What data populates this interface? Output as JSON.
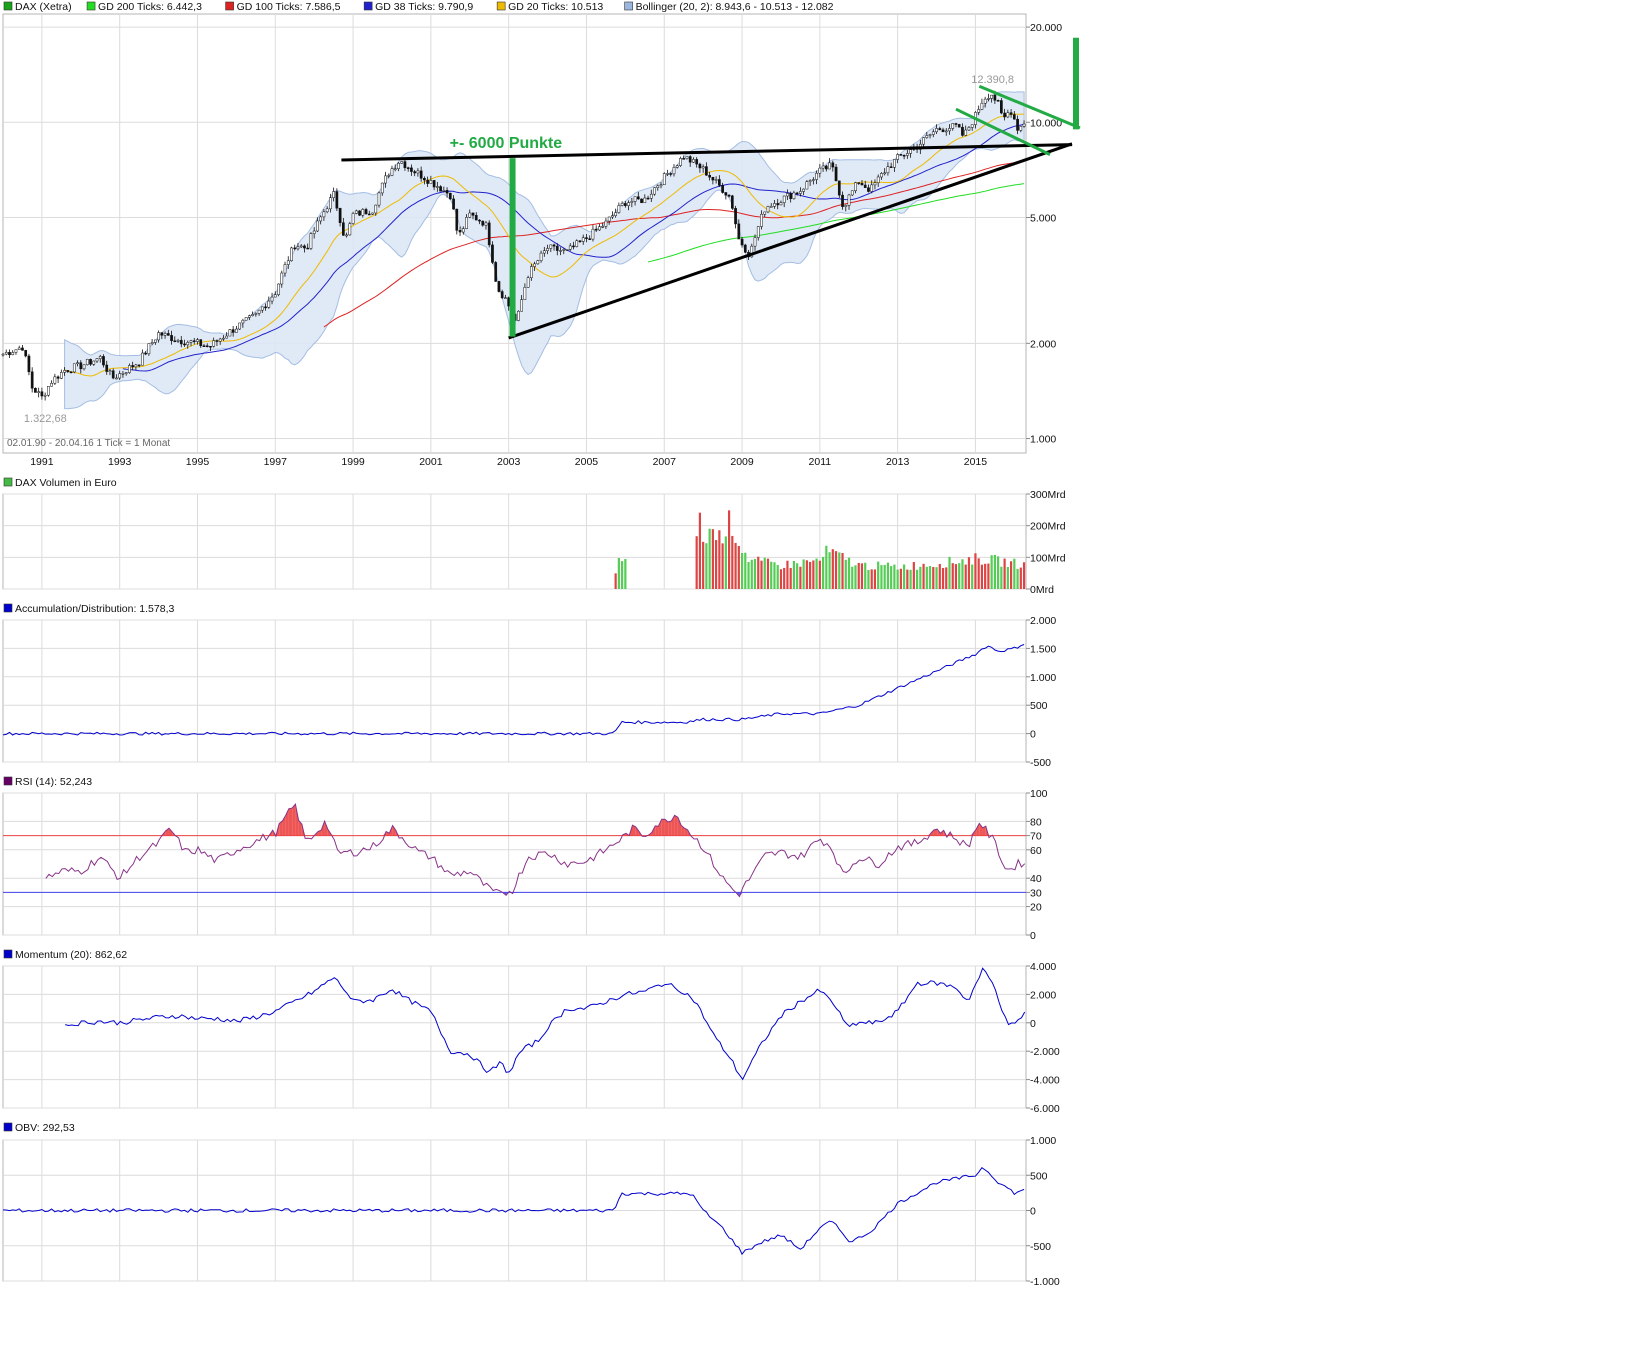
{
  "chart_data": [
    {
      "type": "candlestick",
      "legend": [
        {
          "label": "DAX (Xetra)",
          "color": "#1aa31a"
        },
        {
          "label": "GD 200 Ticks: 6.442,3",
          "color": "#22dd22"
        },
        {
          "label": "GD 100 Ticks: 7.586,5",
          "color": "#dd2222"
        },
        {
          "label": "GD 38 Ticks: 9.790,9",
          "color": "#2222cc"
        },
        {
          "label": "GD 20 Ticks: 10.513",
          "color": "#eebb00"
        },
        {
          "label": "Bollinger (20, 2): 8.943,6 - 10.513 - 12.082",
          "color": "#9bb7e0"
        }
      ],
      "y_scale": "log",
      "ylim": [
        900,
        22000
      ],
      "y_ticks": [
        {
          "value": 1000,
          "label": "1.000"
        },
        {
          "value": 2000,
          "label": "2.000"
        },
        {
          "value": 5000,
          "label": "5.000"
        },
        {
          "value": 10000,
          "label": "10.000"
        },
        {
          "value": 20000,
          "label": "20.000"
        }
      ],
      "x_range": [
        1990.0,
        2016.3
      ],
      "x_ticks": [
        {
          "value": 1991,
          "label": "1991"
        },
        {
          "value": 1993,
          "label": "1993"
        },
        {
          "value": 1995,
          "label": "1995"
        },
        {
          "value": 1997,
          "label": "1997"
        },
        {
          "value": 1999,
          "label": "1999"
        },
        {
          "value": 2001,
          "label": "2001"
        },
        {
          "value": 2003,
          "label": "2003"
        },
        {
          "value": 2005,
          "label": "2005"
        },
        {
          "value": 2007,
          "label": "2007"
        },
        {
          "value": 2009,
          "label": "2009"
        },
        {
          "value": 2011,
          "label": "2011"
        },
        {
          "value": 2013,
          "label": "2013"
        },
        {
          "value": 2015,
          "label": "2015"
        }
      ],
      "price_keypoints": [
        [
          1990.0,
          1850
        ],
        [
          1990.5,
          1950
        ],
        [
          1990.75,
          1450
        ],
        [
          1991.0,
          1350
        ],
        [
          1991.25,
          1520
        ],
        [
          1991.6,
          1650
        ],
        [
          1992.0,
          1700
        ],
        [
          1992.5,
          1800
        ],
        [
          1992.8,
          1550
        ],
        [
          1993.0,
          1600
        ],
        [
          1993.5,
          1750
        ],
        [
          1994.0,
          2150
        ],
        [
          1994.5,
          2050
        ],
        [
          1995.0,
          2000
        ],
        [
          1995.3,
          1950
        ],
        [
          1996.0,
          2250
        ],
        [
          1996.5,
          2450
        ],
        [
          1997.0,
          2900
        ],
        [
          1997.5,
          4100
        ],
        [
          1997.8,
          4000
        ],
        [
          1998.5,
          5900
        ],
        [
          1998.8,
          4200
        ],
        [
          1999.0,
          5100
        ],
        [
          1999.5,
          5300
        ],
        [
          1999.9,
          6900
        ],
        [
          2000.2,
          7600
        ],
        [
          2000.5,
          7100
        ],
        [
          2001.0,
          6500
        ],
        [
          2001.5,
          5900
        ],
        [
          2001.7,
          4300
        ],
        [
          2002.0,
          5100
        ],
        [
          2002.4,
          4800
        ],
        [
          2002.7,
          3000
        ],
        [
          2002.9,
          2800
        ],
        [
          2003.2,
          2300
        ],
        [
          2003.5,
          3300
        ],
        [
          2004.0,
          4000
        ],
        [
          2004.5,
          3900
        ],
        [
          2005.0,
          4300
        ],
        [
          2005.5,
          4800
        ],
        [
          2006.0,
          5600
        ],
        [
          2006.5,
          5700
        ],
        [
          2007.0,
          6700
        ],
        [
          2007.5,
          7800
        ],
        [
          2008.0,
          7100
        ],
        [
          2008.3,
          6500
        ],
        [
          2008.7,
          5800
        ],
        [
          2008.9,
          4300
        ],
        [
          2009.2,
          3800
        ],
        [
          2009.6,
          5400
        ],
        [
          2010.0,
          5700
        ],
        [
          2010.5,
          6100
        ],
        [
          2011.0,
          7000
        ],
        [
          2011.3,
          7300
        ],
        [
          2011.6,
          5400
        ],
        [
          2012.0,
          6500
        ],
        [
          2012.3,
          6100
        ],
        [
          2012.7,
          7100
        ],
        [
          2013.0,
          7700
        ],
        [
          2013.5,
          8400
        ],
        [
          2014.0,
          9500
        ],
        [
          2014.5,
          9700
        ],
        [
          2014.7,
          9000
        ],
        [
          2015.0,
          10500
        ],
        [
          2015.2,
          11900
        ],
        [
          2015.4,
          12390
        ],
        [
          2015.6,
          11300
        ],
        [
          2015.7,
          10100
        ],
        [
          2015.9,
          11000
        ],
        [
          2016.1,
          9500
        ],
        [
          2016.3,
          10150
        ]
      ],
      "annotations": [
        {
          "text": "12.390,8",
          "x": 2015.2,
          "y": 12390.8,
          "type": "high"
        },
        {
          "text": "1.322,68",
          "x": 1991.0,
          "y": 1322.68,
          "type": "low"
        },
        {
          "text": "+- 6000 Punkte",
          "x": 2002.1,
          "y": 8300,
          "color": "#22aa44"
        }
      ],
      "info_text": "02.01.90 - 20.04.16    1 Tick = 1 Monat"
    },
    {
      "type": "bar",
      "legend": [
        {
          "label": "DAX Volumen in Euro",
          "color": "#44bb44"
        }
      ],
      "unit": "Mrd",
      "ylim": [
        0,
        300
      ],
      "y_ticks": [
        {
          "value": 0,
          "label": "0Mrd"
        },
        {
          "value": 100,
          "label": "100Mrd"
        },
        {
          "value": 200,
          "label": "200Mrd"
        },
        {
          "value": 300,
          "label": "300Mrd"
        }
      ],
      "volume_keypoints": [
        [
          2005.7,
          5
        ],
        [
          2005.8,
          80
        ],
        [
          2005.9,
          90
        ],
        [
          2006.0,
          100
        ],
        [
          2007.8,
          140
        ],
        [
          2007.9,
          220
        ],
        [
          2008.0,
          150
        ],
        [
          2008.2,
          190
        ],
        [
          2008.4,
          160
        ],
        [
          2008.7,
          215
        ],
        [
          2008.9,
          150
        ],
        [
          2009.2,
          90
        ],
        [
          2010.0,
          75
        ],
        [
          2011.0,
          90
        ],
        [
          2011.2,
          120
        ],
        [
          2012.0,
          75
        ],
        [
          2013.0,
          70
        ],
        [
          2014.0,
          80
        ],
        [
          2015.0,
          95
        ],
        [
          2015.5,
          90
        ],
        [
          2016.3,
          75
        ]
      ]
    },
    {
      "type": "line",
      "legend": [
        {
          "label": "Accumulation/Distribution: 1.578,3",
          "color": "#0000cc"
        }
      ],
      "ylim": [
        -500,
        2000
      ],
      "y_ticks": [
        {
          "value": -500,
          "label": "-500"
        },
        {
          "value": 0,
          "label": "0"
        },
        {
          "value": 500,
          "label": "500"
        },
        {
          "value": 1000,
          "label": "1.000"
        },
        {
          "value": 1500,
          "label": "1.500"
        },
        {
          "value": 2000,
          "label": "2.000"
        }
      ],
      "keypoints": [
        [
          1990.0,
          0
        ],
        [
          2005.7,
          0
        ],
        [
          2005.9,
          200
        ],
        [
          2007.5,
          200
        ],
        [
          2008.0,
          250
        ],
        [
          2009.0,
          250
        ],
        [
          2010.0,
          350
        ],
        [
          2011.0,
          350
        ],
        [
          2012.0,
          500
        ],
        [
          2013.0,
          800
        ],
        [
          2014.0,
          1100
        ],
        [
          2015.0,
          1400
        ],
        [
          2015.3,
          1550
        ],
        [
          2015.6,
          1450
        ],
        [
          2016.0,
          1500
        ],
        [
          2016.3,
          1600
        ]
      ]
    },
    {
      "type": "line",
      "legend": [
        {
          "label": "RSI (14): 52,243",
          "color": "#660066"
        }
      ],
      "ylim": [
        0,
        100
      ],
      "y_ticks": [
        {
          "value": 0,
          "label": "0"
        },
        {
          "value": 20,
          "label": "20"
        },
        {
          "value": 30,
          "label": "30"
        },
        {
          "value": 40,
          "label": "40"
        },
        {
          "value": 60,
          "label": "60"
        },
        {
          "value": 70,
          "label": "70"
        },
        {
          "value": 80,
          "label": "80"
        },
        {
          "value": 100,
          "label": "100"
        }
      ],
      "overbought": 70,
      "oversold": 30,
      "keypoints": [
        [
          1991.1,
          40
        ],
        [
          1991.5,
          45
        ],
        [
          1992.0,
          45
        ],
        [
          1992.5,
          55
        ],
        [
          1993.0,
          40
        ],
        [
          1993.5,
          55
        ],
        [
          1994.0,
          65
        ],
        [
          1994.3,
          75
        ],
        [
          1994.7,
          58
        ],
        [
          1995.0,
          60
        ],
        [
          1995.5,
          52
        ],
        [
          1996.0,
          60
        ],
        [
          1996.5,
          66
        ],
        [
          1997.0,
          72
        ],
        [
          1997.5,
          92
        ],
        [
          1997.8,
          65
        ],
        [
          1998.3,
          80
        ],
        [
          1998.6,
          58
        ],
        [
          1999.0,
          58
        ],
        [
          1999.5,
          62
        ],
        [
          2000.0,
          75
        ],
        [
          2000.3,
          68
        ],
        [
          2000.7,
          58
        ],
        [
          2001.0,
          55
        ],
        [
          2001.5,
          42
        ],
        [
          2002.0,
          45
        ],
        [
          2002.5,
          32
        ],
        [
          2002.8,
          28
        ],
        [
          2003.1,
          32
        ],
        [
          2003.5,
          55
        ],
        [
          2004.0,
          58
        ],
        [
          2004.5,
          50
        ],
        [
          2005.0,
          52
        ],
        [
          2005.5,
          60
        ],
        [
          2006.0,
          70
        ],
        [
          2006.2,
          75
        ],
        [
          2006.5,
          70
        ],
        [
          2006.8,
          78
        ],
        [
          2007.0,
          80
        ],
        [
          2007.3,
          85
        ],
        [
          2007.6,
          74
        ],
        [
          2008.0,
          62
        ],
        [
          2008.5,
          40
        ],
        [
          2008.9,
          28
        ],
        [
          2009.2,
          40
        ],
        [
          2009.6,
          56
        ],
        [
          2010.0,
          58
        ],
        [
          2010.5,
          55
        ],
        [
          2011.0,
          68
        ],
        [
          2011.3,
          62
        ],
        [
          2011.6,
          42
        ],
        [
          2012.0,
          55
        ],
        [
          2012.5,
          50
        ],
        [
          2013.0,
          62
        ],
        [
          2013.5,
          65
        ],
        [
          2014.0,
          75
        ],
        [
          2014.5,
          68
        ],
        [
          2014.8,
          62
        ],
        [
          2015.1,
          80
        ],
        [
          2015.5,
          65
        ],
        [
          2015.8,
          45
        ],
        [
          2016.1,
          50
        ],
        [
          2016.3,
          52
        ]
      ]
    },
    {
      "type": "line",
      "legend": [
        {
          "label": "Momentum (20): 862,62",
          "color": "#0000cc"
        }
      ],
      "ylim": [
        -6000,
        4000
      ],
      "y_ticks": [
        {
          "value": -6000,
          "label": "-6.000"
        },
        {
          "value": -4000,
          "label": "-4.000"
        },
        {
          "value": -2000,
          "label": "-2.000"
        },
        {
          "value": 0,
          "label": "0"
        },
        {
          "value": 2000,
          "label": "2.000"
        },
        {
          "value": 4000,
          "label": "4.000"
        }
      ],
      "keypoints": [
        [
          1991.6,
          -200
        ],
        [
          1992.0,
          0
        ],
        [
          1992.5,
          100
        ],
        [
          1993.0,
          0
        ],
        [
          1993.5,
          200
        ],
        [
          1994.0,
          400
        ],
        [
          1994.5,
          500
        ],
        [
          1995.0,
          300
        ],
        [
          1995.5,
          300
        ],
        [
          1996.0,
          100
        ],
        [
          1996.5,
          400
        ],
        [
          1997.0,
          800
        ],
        [
          1997.5,
          1500
        ],
        [
          1998.0,
          2200
        ],
        [
          1998.5,
          3200
        ],
        [
          1998.8,
          2300
        ],
        [
          1999.0,
          1500
        ],
        [
          1999.5,
          1600
        ],
        [
          2000.0,
          2400
        ],
        [
          2000.3,
          1800
        ],
        [
          2000.7,
          1200
        ],
        [
          2001.0,
          800
        ],
        [
          2001.5,
          -2000
        ],
        [
          2002.0,
          -2200
        ],
        [
          2002.5,
          -3500
        ],
        [
          2002.8,
          -2800
        ],
        [
          2003.0,
          -3600
        ],
        [
          2003.3,
          -2000
        ],
        [
          2003.8,
          -1200
        ],
        [
          2004.0,
          -300
        ],
        [
          2004.5,
          1000
        ],
        [
          2005.0,
          1000
        ],
        [
          2005.5,
          1500
        ],
        [
          2006.0,
          2000
        ],
        [
          2006.5,
          2200
        ],
        [
          2007.0,
          2800
        ],
        [
          2007.5,
          2200
        ],
        [
          2007.8,
          1500
        ],
        [
          2008.3,
          -1000
        ],
        [
          2008.7,
          -2500
        ],
        [
          2009.0,
          -4000
        ],
        [
          2009.5,
          -1500
        ],
        [
          2010.0,
          500
        ],
        [
          2010.5,
          1500
        ],
        [
          2011.0,
          2300
        ],
        [
          2011.4,
          1200
        ],
        [
          2011.7,
          -300
        ],
        [
          2012.0,
          0
        ],
        [
          2012.5,
          0
        ],
        [
          2013.0,
          800
        ],
        [
          2013.5,
          2800
        ],
        [
          2014.0,
          2800
        ],
        [
          2014.5,
          2500
        ],
        [
          2014.8,
          1500
        ],
        [
          2015.2,
          3800
        ],
        [
          2015.5,
          2500
        ],
        [
          2015.8,
          0
        ],
        [
          2016.0,
          -200
        ],
        [
          2016.3,
          860
        ]
      ]
    },
    {
      "type": "line",
      "legend": [
        {
          "label": "OBV: 292,53",
          "color": "#0000cc"
        }
      ],
      "ylim": [
        -1000,
        1000
      ],
      "y_ticks": [
        {
          "value": -1000,
          "label": "-1.000"
        },
        {
          "value": -500,
          "label": "-500"
        },
        {
          "value": 0,
          "label": "0"
        },
        {
          "value": 500,
          "label": "500"
        },
        {
          "value": 1000,
          "label": "1.000"
        }
      ],
      "keypoints": [
        [
          1990.0,
          0
        ],
        [
          2005.7,
          0
        ],
        [
          2005.9,
          240
        ],
        [
          2007.7,
          240
        ],
        [
          2008.0,
          0
        ],
        [
          2008.5,
          -250
        ],
        [
          2009.0,
          -600
        ],
        [
          2009.5,
          -450
        ],
        [
          2010.0,
          -350
        ],
        [
          2010.5,
          -550
        ],
        [
          2011.0,
          -250
        ],
        [
          2011.3,
          -150
        ],
        [
          2011.8,
          -450
        ],
        [
          2012.3,
          -300
        ],
        [
          2013.0,
          100
        ],
        [
          2013.5,
          250
        ],
        [
          2014.0,
          400
        ],
        [
          2014.5,
          450
        ],
        [
          2015.0,
          500
        ],
        [
          2015.2,
          620
        ],
        [
          2015.6,
          400
        ],
        [
          2016.0,
          250
        ],
        [
          2016.3,
          290
        ]
      ]
    }
  ]
}
